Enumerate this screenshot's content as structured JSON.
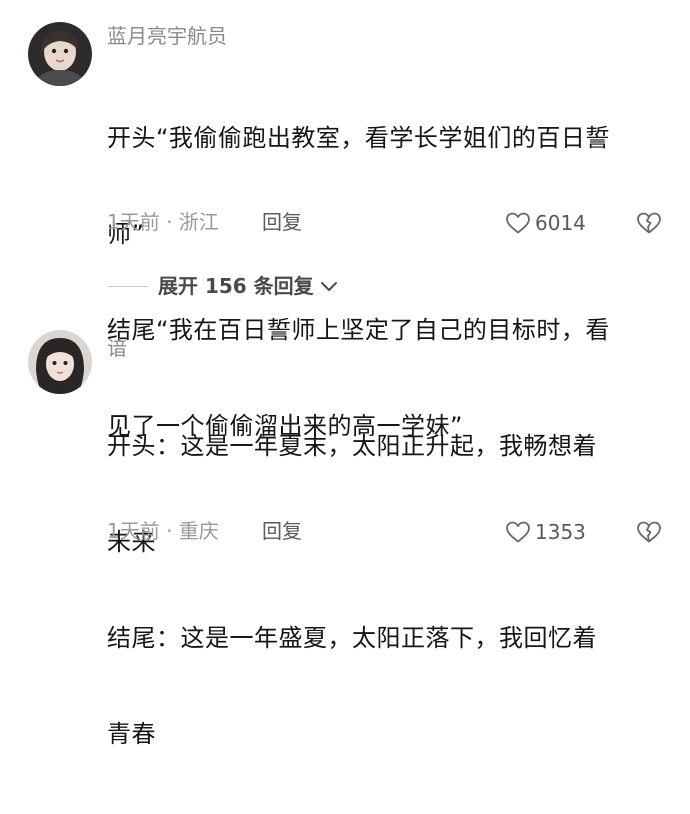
{
  "comments": [
    {
      "username": "蓝月亮宇航员",
      "lines": [
        "开头“我偷偷跑出教室，看学长学姐们的百日誓",
        "师”",
        "结尾“我在百日誓师上坚定了自己的目标时，看",
        "见了一个偷偷溜出来的高一学妹”"
      ],
      "meta": "1天前 · 浙江",
      "reply_label": "回复",
      "like_count": "6014"
    },
    {
      "username": "谙",
      "lines": [
        "开头：这是一年夏末，太阳正升起，我畅想着",
        "未来",
        "结尾：这是一年盛夏，太阳正落下，我回忆着",
        "青春"
      ],
      "meta": "1天前 · 重庆",
      "reply_label": "回复",
      "like_count": "1353"
    }
  ],
  "expand_replies": {
    "label": "展开 156 条回复"
  },
  "icons": {
    "like": "heart-outline-icon",
    "dislike": "broken-heart-icon",
    "expand": "chevron-down-icon"
  }
}
